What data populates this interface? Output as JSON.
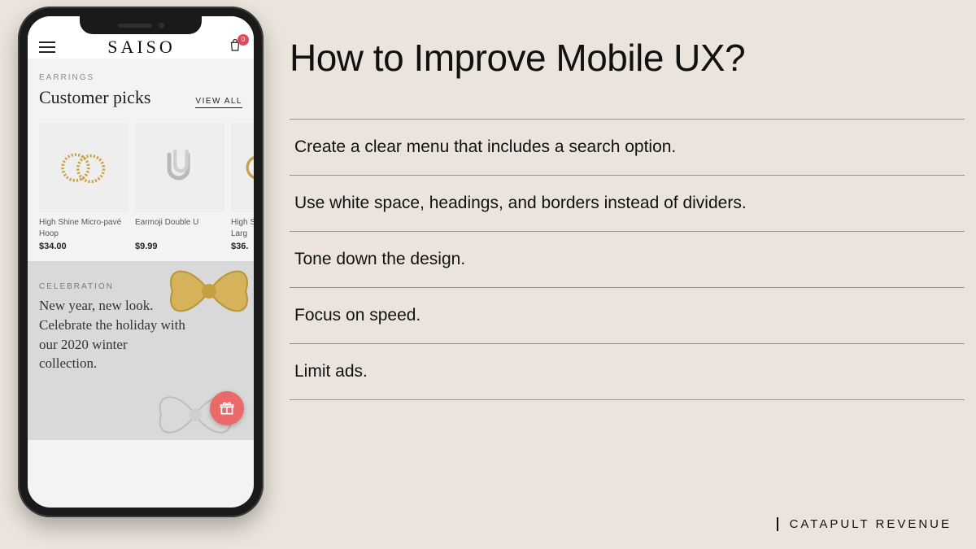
{
  "app": {
    "brand": "SAISO",
    "cart_count": "0",
    "section_eyebrow": "EARRINGS",
    "section_title": "Customer picks",
    "view_all": "VIEW ALL",
    "products": [
      {
        "name": "High Shine Micro-pavé Hoop",
        "price": "$34.00"
      },
      {
        "name": "Earmoji Double U",
        "price": "$9.99"
      },
      {
        "name": "High S\n- Larg",
        "price": "$36."
      }
    ],
    "promo_eyebrow": "CELEBRATION",
    "promo_copy": "New year, new look. Celebrate the holiday with our 2020 winter collection."
  },
  "slide": {
    "title": "How to Improve Mobile UX?",
    "items": [
      "Create a clear menu that includes a search option.",
      "Use white space, headings, and borders instead of dividers.",
      "Tone down the design.",
      "Focus on speed.",
      "Limit ads."
    ]
  },
  "footer_brand": "CATAPULT REVENUE"
}
